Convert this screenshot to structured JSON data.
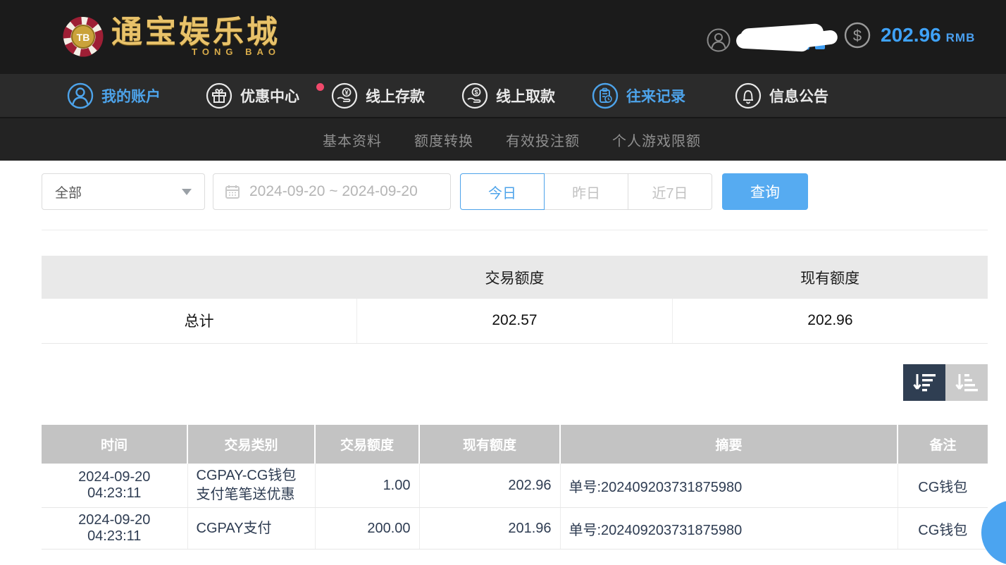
{
  "header": {
    "logo": {
      "chip_text": "TB",
      "title": "通宝娱乐城",
      "subtitle": "TONG BAO"
    },
    "username_masked": true,
    "balance": {
      "amount": "202.96",
      "currency": "RMB"
    }
  },
  "nav": {
    "items": [
      {
        "label": "我的账户",
        "icon": "user-icon",
        "active": true
      },
      {
        "label": "优惠中心",
        "icon": "gift-icon",
        "active": false,
        "badge_dot": true
      },
      {
        "label": "线上存款",
        "icon": "deposit-icon",
        "active": false
      },
      {
        "label": "线上取款",
        "icon": "withdraw-icon",
        "active": false
      },
      {
        "label": "往来记录",
        "icon": "records-icon",
        "active": true
      },
      {
        "label": "信息公告",
        "icon": "bell-icon",
        "active": false
      }
    ]
  },
  "subnav": {
    "items": [
      {
        "label": "基本资料"
      },
      {
        "label": "额度转换"
      },
      {
        "label": "有效投注额"
      },
      {
        "label": "个人游戏限额"
      }
    ]
  },
  "filters": {
    "type_select": {
      "value": "全部"
    },
    "date_range": {
      "value": "2024-09-20 ~ 2024-09-20"
    },
    "quick_ranges": [
      {
        "label": "今日",
        "active": true
      },
      {
        "label": "昨日",
        "active": false
      },
      {
        "label": "近7日",
        "active": false
      }
    ],
    "search_label": "查询"
  },
  "summary": {
    "headers": [
      "",
      "交易额度",
      "现有额度"
    ],
    "rows": [
      [
        "总计",
        "202.57",
        "202.96"
      ]
    ]
  },
  "records": {
    "headers": [
      "时间",
      "交易类别",
      "交易额度",
      "现有额度",
      "摘要",
      "备注"
    ],
    "rows": [
      [
        "2024-09-20 04:23:11",
        "CGPAY-CG钱包支付笔笔送优惠",
        "1.00",
        "202.96",
        "单号:202409203731875980",
        "CG钱包"
      ],
      [
        "2024-09-20 04:23:11",
        "CGPAY支付",
        "200.00",
        "201.96",
        "单号:202409203731875980",
        "CG钱包"
      ]
    ]
  },
  "colors": {
    "accent_blue": "#4da3ea",
    "balance_blue": "#3fa2f7",
    "search_button": "#56abf1",
    "topbar_bg": "#1b1b1b",
    "mainnav_bg": "#2b2b2b",
    "subnav_bg": "#232323",
    "summary_header_bg": "#e9e9e9",
    "records_header_bg": "#c3c3c3",
    "sort_active_bg": "#2f3e52",
    "sort_inactive_bg": "#cbcbcb",
    "notification_dot": "#f0496b",
    "logo_gold": "#e8c26a",
    "float_button": "#4ba4f0"
  }
}
